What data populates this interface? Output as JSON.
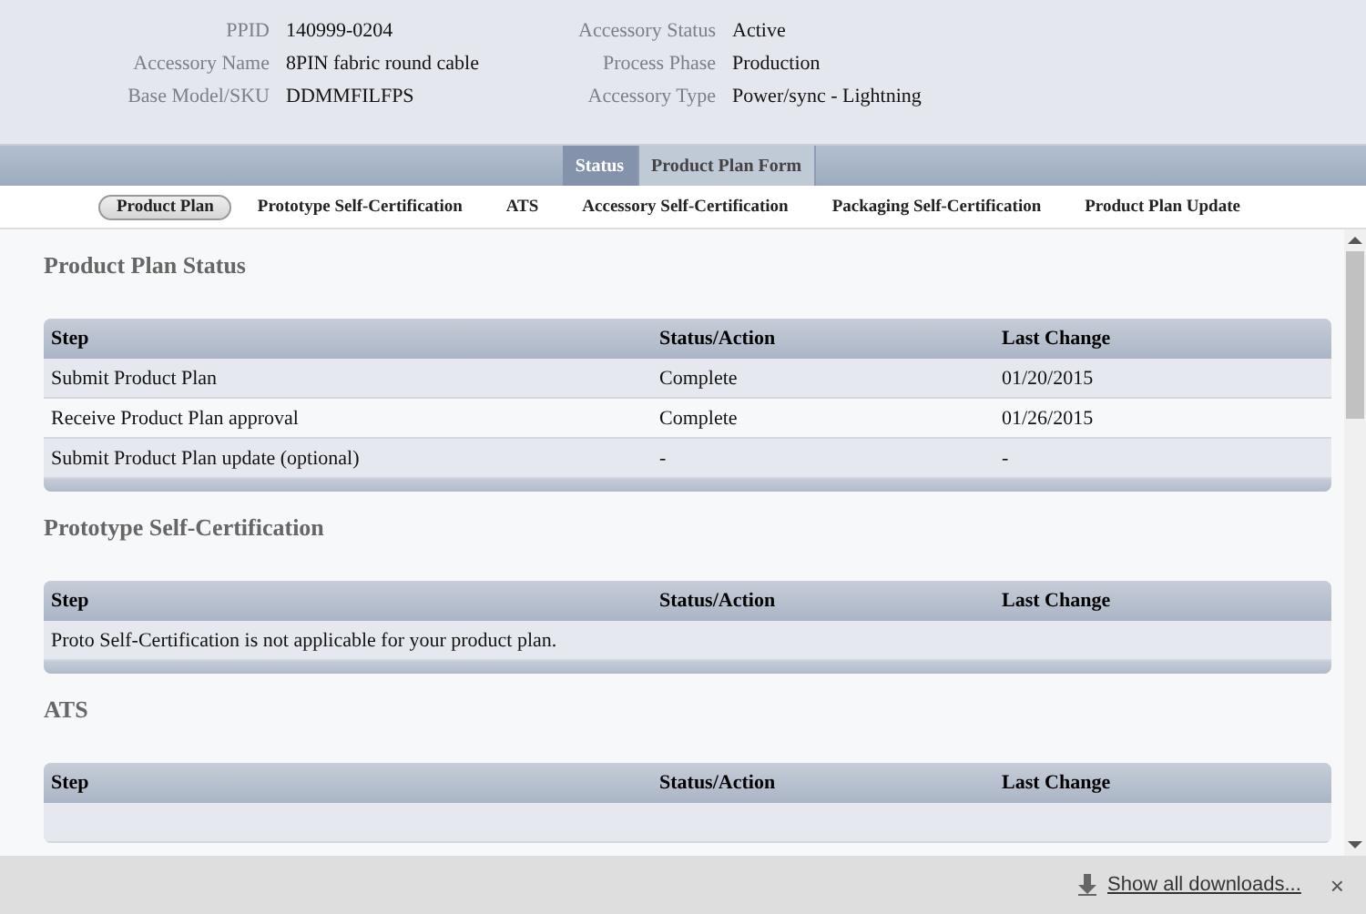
{
  "details": {
    "left": [
      {
        "label": "PPID",
        "value": "140999-0204"
      },
      {
        "label": "Accessory Name",
        "value": "8PIN fabric round cable"
      },
      {
        "label": "Base Model/SKU",
        "value": "DDMMFILFPS"
      }
    ],
    "right": [
      {
        "label": "Accessory Status",
        "value": "Active"
      },
      {
        "label": "Process Phase",
        "value": "Production"
      },
      {
        "label": "Accessory Type",
        "value": "Power/sync - Lightning"
      }
    ]
  },
  "tabs": [
    {
      "label": "Status",
      "selected": true
    },
    {
      "label": "Product Plan Form",
      "selected": false
    }
  ],
  "subnav": [
    {
      "label": "Product Plan",
      "selected": true
    },
    {
      "label": "Prototype Self-Certification",
      "selected": false
    },
    {
      "label": "ATS",
      "selected": false
    },
    {
      "label": "Accessory Self-Certification",
      "selected": false
    },
    {
      "label": "Packaging Self-Certification",
      "selected": false
    },
    {
      "label": "Product Plan Update",
      "selected": false
    }
  ],
  "sections": [
    {
      "title": "Product Plan Status",
      "columns": [
        "Step",
        "Status/Action",
        "Last Change"
      ],
      "rows": [
        {
          "kind": "cells",
          "cells": [
            "Submit Product Plan",
            "Complete",
            "01/20/2015"
          ]
        },
        {
          "kind": "cells",
          "cells": [
            "Receive Product Plan approval",
            "Complete",
            "01/26/2015"
          ]
        },
        {
          "kind": "cells",
          "cells": [
            "Submit Product Plan update (optional)",
            "-",
            "-"
          ]
        }
      ]
    },
    {
      "title": "Prototype Self-Certification",
      "columns": [
        "Step",
        "Status/Action",
        "Last Change"
      ],
      "rows": [
        {
          "kind": "note",
          "text": "Proto Self-Certification is not applicable for your product plan."
        }
      ]
    },
    {
      "title": "ATS",
      "columns": [
        "Step",
        "Status/Action",
        "Last Change"
      ]
    }
  ],
  "download_bar": {
    "link": "Show all downloads...",
    "close": "×"
  }
}
